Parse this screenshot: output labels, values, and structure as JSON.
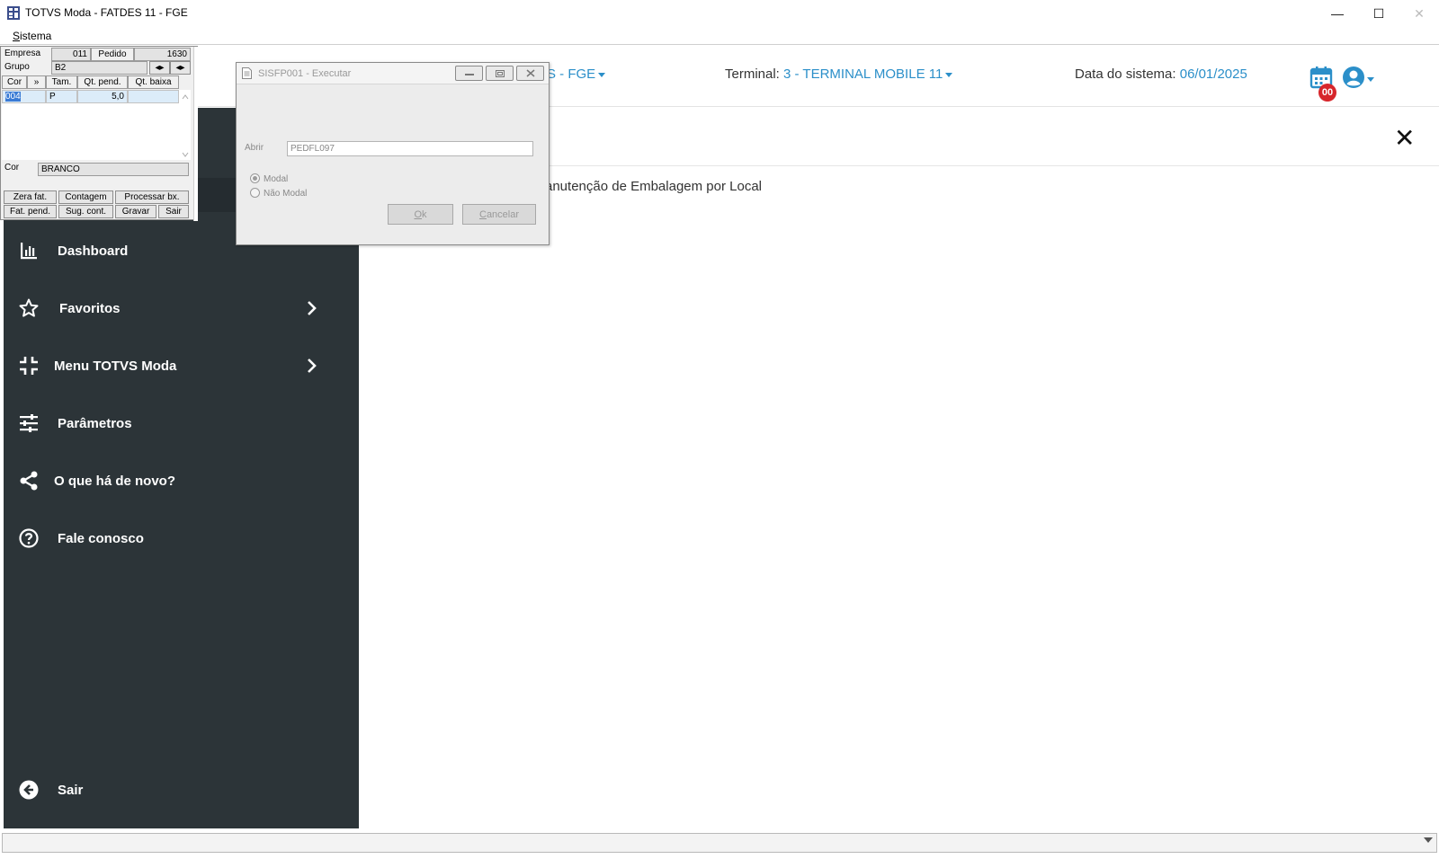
{
  "window": {
    "title": "TOTVS Moda - FATDES 11 - FGE",
    "controls": {
      "minimize": "—",
      "maximize": "☐",
      "close": "✕"
    }
  },
  "menubar": {
    "items": [
      {
        "label": "Sistema",
        "mnemonic": "S"
      }
    ]
  },
  "header": {
    "company_partial": "ES - FGE",
    "terminal_label": "Terminal:",
    "terminal_value": "3 - TERMINAL MOBILE 11",
    "date_label": "Data do sistema:",
    "date_value": "06/01/2025",
    "notification_count": "00",
    "icons": {
      "calendar": "calendar-icon",
      "user": "user-circle-icon"
    }
  },
  "content": {
    "heading_partial": "anutenção de Embalagem por Local",
    "close_glyph": "✕"
  },
  "sidebar": {
    "bg_color": "#2c3438",
    "items": [
      {
        "label": "Dashboard",
        "icon": "bar-chart-icon",
        "has_submenu": false
      },
      {
        "label": "Favoritos",
        "icon": "star-icon",
        "has_submenu": true
      },
      {
        "label": "Menu TOTVS Moda",
        "icon": "compress-icon",
        "has_submenu": true
      },
      {
        "label": "Parâmetros",
        "icon": "sliders-icon",
        "has_submenu": false
      },
      {
        "label": "O que há de novo?",
        "icon": "share-icon",
        "has_submenu": false
      },
      {
        "label": "Fale conosco",
        "icon": "question-circle-icon",
        "has_submenu": false
      }
    ],
    "exit": {
      "label": "Sair",
      "icon": "arrow-left-circle-icon"
    }
  },
  "legacy_window": {
    "empresa_label": "Empresa",
    "empresa_value": "011",
    "pedido_label": "Pedido",
    "pedido_value": "1630",
    "grupo_label": "Grupo",
    "grupo_value": "B2",
    "grid_headers": {
      "cor": "Cor",
      "expand": "»",
      "tam": "Tam.",
      "qt_pend": "Qt. pend.",
      "qt_baixa": "Qt. baixa"
    },
    "grid_rows": [
      {
        "cor": "004",
        "tam": "P",
        "qt_pend": "5,0",
        "qt_baixa": ""
      }
    ],
    "cor_label": "Cor",
    "cor_value": "BRANCO",
    "buttons_row1": [
      "Zera fat.",
      "Contagem",
      "Processar bx."
    ],
    "buttons_row2": [
      "Fat. pend.",
      "Sug. cont.",
      "Gravar",
      "Sair"
    ]
  },
  "dialog": {
    "title": "SISFP001 - Executar",
    "abrir_label": "Abrir",
    "abrir_value": "PEDFL097",
    "radio_modal": "Modal",
    "radio_nao_modal": "Não Modal",
    "modal_selected": true,
    "ok_label": "Ok",
    "ok_mnemonic": "O",
    "cancel_label": "Cancelar",
    "cancel_mnemonic": "C"
  },
  "colors": {
    "accent": "#2b8fc9",
    "sidebar": "#2c3438",
    "badge": "#d7262b"
  }
}
